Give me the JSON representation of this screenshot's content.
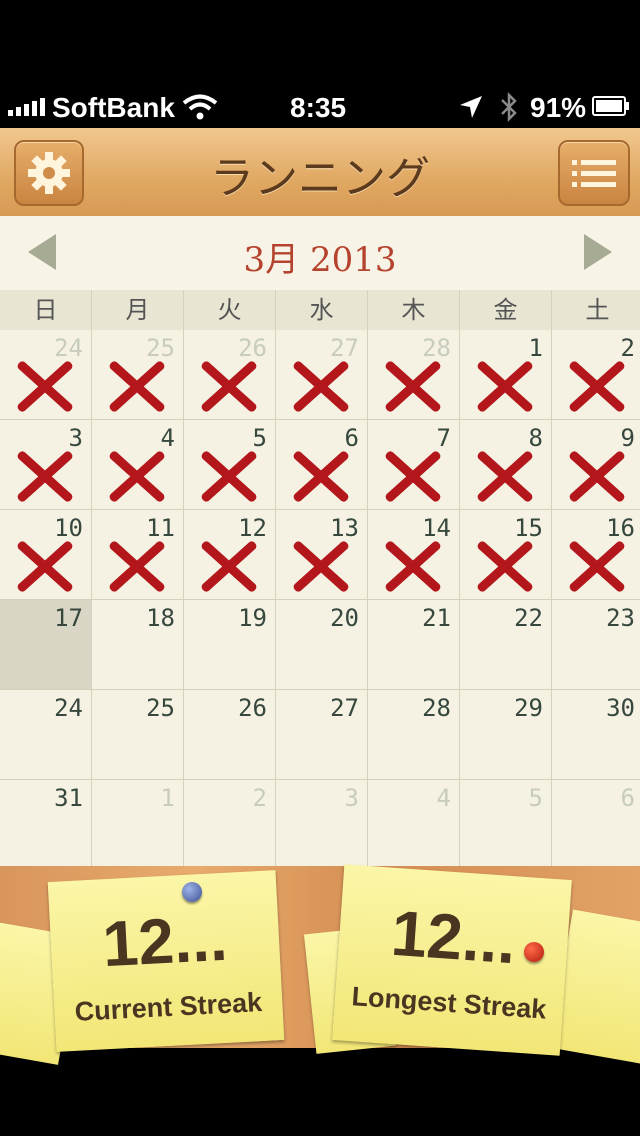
{
  "status_bar": {
    "carrier": "SoftBank",
    "time": "8:35",
    "battery": "91%"
  },
  "nav": {
    "title": "ランニング",
    "settings_icon": "gear-icon",
    "list_icon": "list-icon"
  },
  "calendar": {
    "month_label": "3月 2013",
    "weekdays": [
      "日",
      "月",
      "火",
      "水",
      "木",
      "金",
      "土"
    ],
    "days": [
      {
        "n": "24",
        "other": true,
        "x": true
      },
      {
        "n": "25",
        "other": true,
        "x": true
      },
      {
        "n": "26",
        "other": true,
        "x": true
      },
      {
        "n": "27",
        "other": true,
        "x": true
      },
      {
        "n": "28",
        "other": true,
        "x": true
      },
      {
        "n": "1",
        "x": true
      },
      {
        "n": "2",
        "x": true
      },
      {
        "n": "3",
        "x": true
      },
      {
        "n": "4",
        "x": true
      },
      {
        "n": "5",
        "x": true
      },
      {
        "n": "6",
        "x": true
      },
      {
        "n": "7",
        "x": true
      },
      {
        "n": "8",
        "x": true
      },
      {
        "n": "9",
        "x": true
      },
      {
        "n": "10",
        "x": true
      },
      {
        "n": "11",
        "x": true
      },
      {
        "n": "12",
        "x": true
      },
      {
        "n": "13",
        "x": true
      },
      {
        "n": "14",
        "x": true
      },
      {
        "n": "15",
        "x": true
      },
      {
        "n": "16",
        "x": true
      },
      {
        "n": "17",
        "today": true
      },
      {
        "n": "18"
      },
      {
        "n": "19"
      },
      {
        "n": "20"
      },
      {
        "n": "21"
      },
      {
        "n": "22"
      },
      {
        "n": "23"
      },
      {
        "n": "24"
      },
      {
        "n": "25"
      },
      {
        "n": "26"
      },
      {
        "n": "27"
      },
      {
        "n": "28"
      },
      {
        "n": "29"
      },
      {
        "n": "30"
      },
      {
        "n": "31"
      },
      {
        "n": "1",
        "other": true
      },
      {
        "n": "2",
        "other": true
      },
      {
        "n": "3",
        "other": true
      },
      {
        "n": "4",
        "other": true
      },
      {
        "n": "5",
        "other": true
      },
      {
        "n": "6",
        "other": true
      }
    ]
  },
  "streaks": {
    "current_value": "12...",
    "current_label": "Current Streak",
    "longest_value": "12...",
    "longest_label": "Longest Streak"
  }
}
